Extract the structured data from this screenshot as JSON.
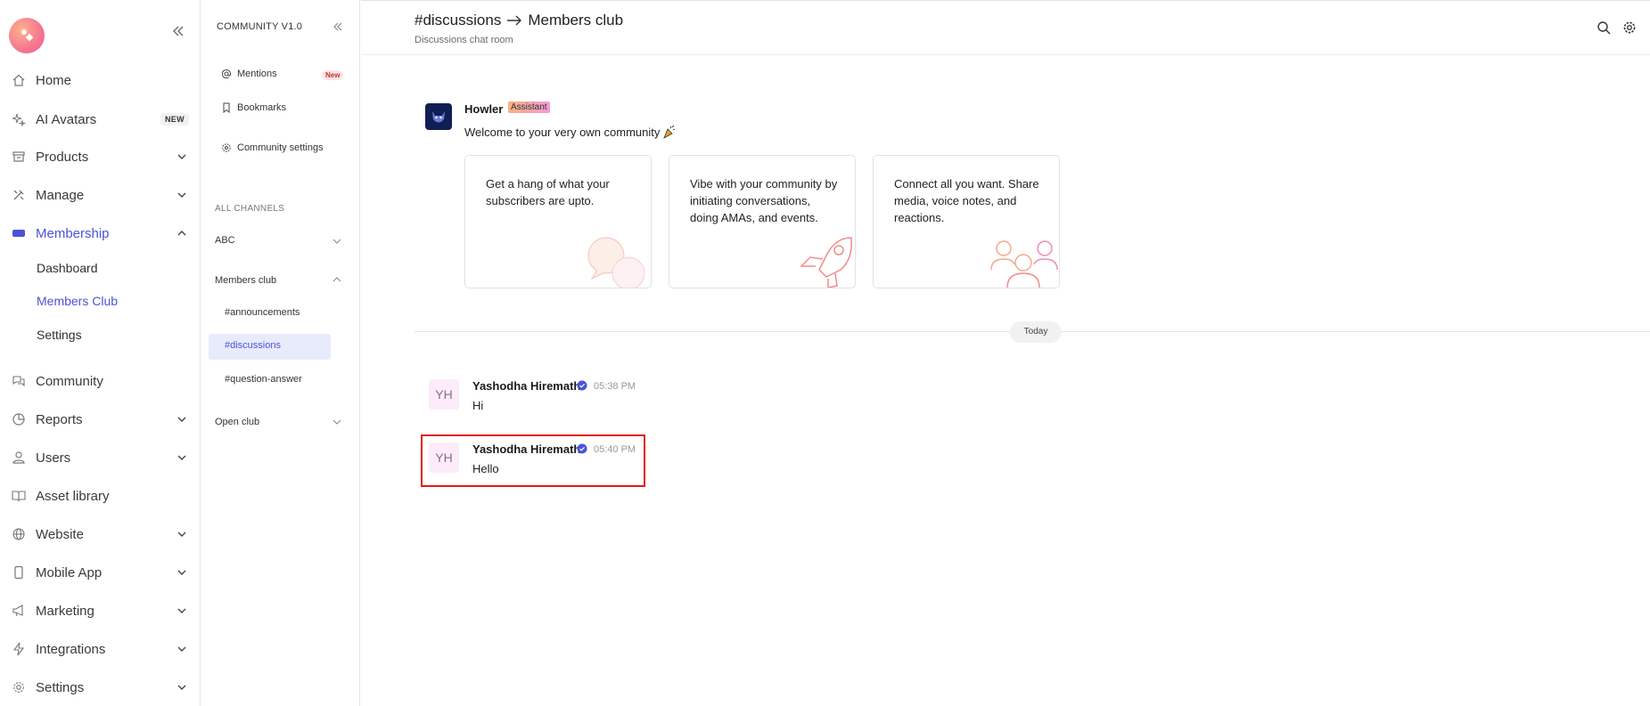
{
  "sidebar": {
    "items": [
      {
        "label": "Home"
      },
      {
        "label": "AI Avatars",
        "badge": "NEW"
      },
      {
        "label": "Products"
      },
      {
        "label": "Manage"
      },
      {
        "label": "Membership"
      },
      {
        "label": "Community"
      },
      {
        "label": "Reports"
      },
      {
        "label": "Users"
      },
      {
        "label": "Asset library"
      },
      {
        "label": "Website"
      },
      {
        "label": "Mobile App"
      },
      {
        "label": "Marketing"
      },
      {
        "label": "Integrations"
      },
      {
        "label": "Settings"
      }
    ],
    "membership_sub": [
      "Dashboard",
      "Members Club",
      "Settings"
    ],
    "accent": "#4b53d6"
  },
  "community": {
    "title": "COMMUNITY V1.0",
    "mentions": "Mentions",
    "mentions_badge": "New",
    "bookmarks": "Bookmarks",
    "settings": "Community settings",
    "section": "ALL CHANNELS",
    "groups": [
      "ABC",
      "Members club",
      "Open club"
    ],
    "channels": [
      "#announcements",
      "#discussions",
      "#question-answer"
    ]
  },
  "header": {
    "channel": "#discussions",
    "club": "Members club",
    "subtitle": "Discussions chat room"
  },
  "assistant": {
    "name": "Howler",
    "tag": "Assistant",
    "welcome": "Welcome to your very own community"
  },
  "cards": [
    "Get a hang of what your subscribers are upto.",
    "Vibe with your community by initiating conversations, doing AMAs, and events.",
    "Connect all you want. Share media, voice notes, and reactions."
  ],
  "day_label": "Today",
  "messages": [
    {
      "initials": "YH",
      "author": "Yashodha Hiremath",
      "time": "05:38 PM",
      "text": "Hi"
    },
    {
      "initials": "YH",
      "author": "Yashodha Hiremath",
      "time": "05:40 PM",
      "text": "Hello"
    }
  ],
  "icons": {
    "topbar": [
      "search-icon",
      "gear-icon"
    ]
  }
}
